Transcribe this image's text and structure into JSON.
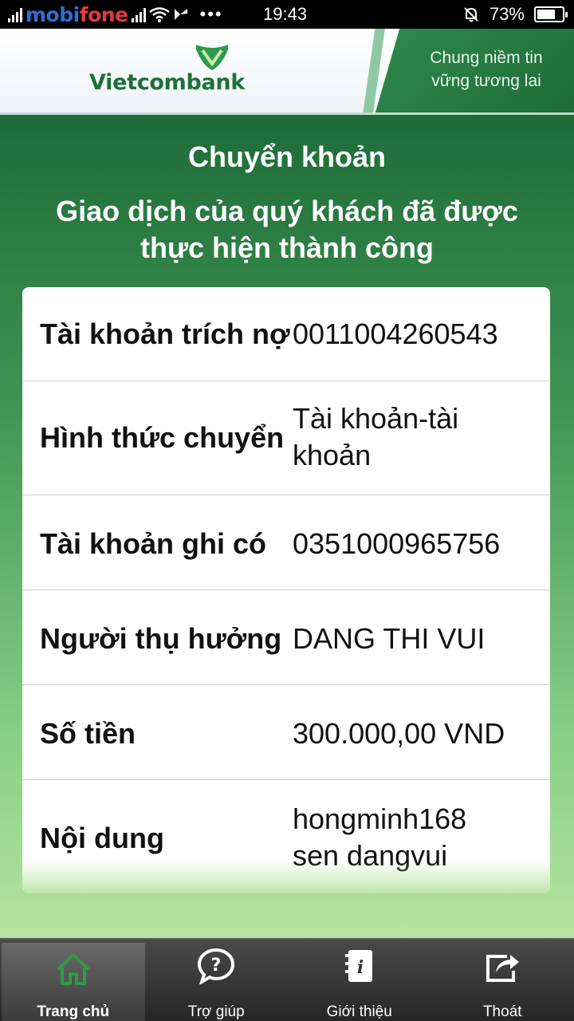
{
  "status_bar": {
    "carrier_part1": "mobi",
    "carrier_part2": "fone",
    "time": "19:43",
    "battery_percent": "73%",
    "battery_level": 0.73,
    "dots": "•••"
  },
  "banner": {
    "bank_name": "Vietcombank",
    "slogan_line1": "Chung niềm tin",
    "slogan_line2": "vững tương lai",
    "brand_color": "#1f6f3a"
  },
  "page": {
    "title": "Chuyển khoản",
    "message": "Giao dịch của quý khách đã được thực hiện thành công"
  },
  "details": [
    {
      "label": "Tài khoản trích nợ",
      "value": "0011004260543"
    },
    {
      "label": "Hình thức chuyển",
      "value": "Tài khoản-tài khoản"
    },
    {
      "label": "Tài khoản ghi có",
      "value": "0351000965756"
    },
    {
      "label": "Người thụ hưởng",
      "value": "DANG THI VUI"
    },
    {
      "label": "Số tiền",
      "value": "300.000,00 VND"
    },
    {
      "label": "Nội dung",
      "value": "hongminh168 sen dangvui"
    }
  ],
  "bottom_nav": [
    {
      "label": "Trang chủ",
      "icon": "home-icon",
      "active": true
    },
    {
      "label": "Trợ giúp",
      "icon": "help-icon",
      "active": false
    },
    {
      "label": "Giới thiệu",
      "icon": "info-icon",
      "active": false
    },
    {
      "label": "Thoát",
      "icon": "exit-icon",
      "active": false
    }
  ]
}
